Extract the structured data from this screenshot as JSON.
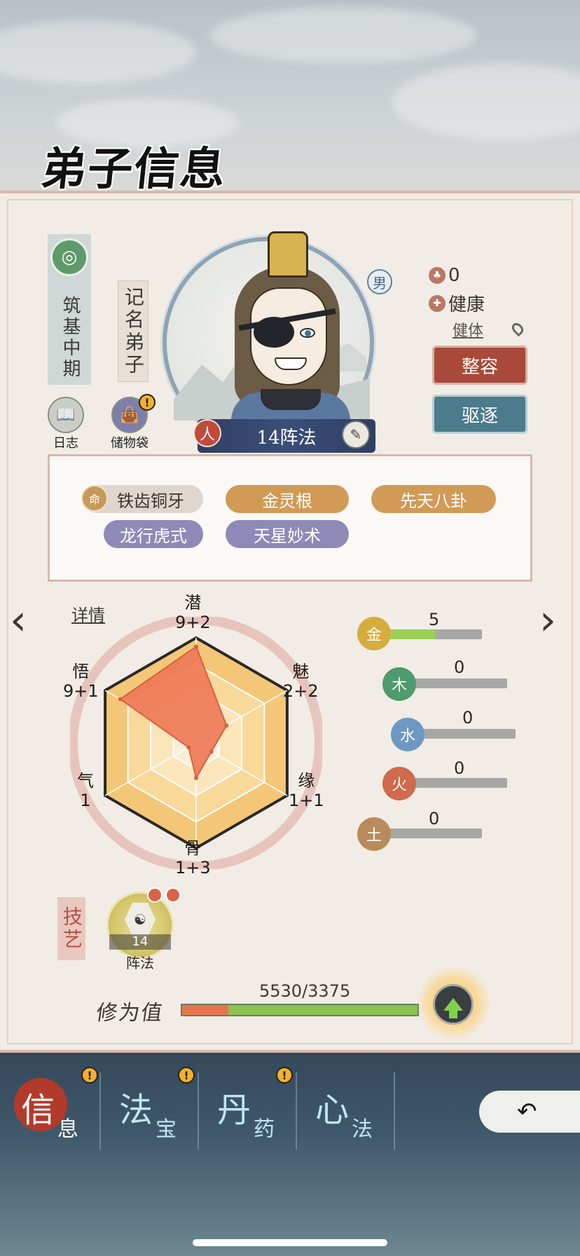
{
  "header": {
    "title": "弟子信息"
  },
  "disciple": {
    "rank": "筑基中期",
    "title_tag": "记名弟子",
    "gender": "男",
    "skill_band": "14阵法",
    "ren_badge": "人",
    "stat_count": "0",
    "health": "健康",
    "constitution": "健体",
    "buttons": {
      "reshape": "整容",
      "expel": "驱逐"
    }
  },
  "items": [
    {
      "label": "日志",
      "icon": "book-icon"
    },
    {
      "label": "储物袋",
      "icon": "bag-icon",
      "alert": "!"
    }
  ],
  "traits": {
    "ming_icon": "命",
    "row1": [
      "铁齿铜牙",
      "金灵根",
      "先天八卦"
    ],
    "row2": [
      "龙行虎式",
      "天星妙术"
    ]
  },
  "detail_link": "详情",
  "chart_data": {
    "type": "radar",
    "axes": [
      {
        "name": "潜",
        "label": "9+2",
        "base": 9,
        "bonus": 2
      },
      {
        "name": "魅",
        "label": "2+2",
        "base": 2,
        "bonus": 2
      },
      {
        "name": "缘",
        "label": "1+1",
        "base": 1,
        "bonus": 1
      },
      {
        "name": "骨",
        "label": "1+3",
        "base": 1,
        "bonus": 3
      },
      {
        "name": "气",
        "label": "1",
        "base": 1,
        "bonus": 0
      },
      {
        "name": "悟",
        "label": "9+1",
        "base": 9,
        "bonus": 1
      }
    ],
    "colors": {
      "fill": "#ee7a57",
      "bg_outer": "#f3c777",
      "bg_inner": "#fdf0d6"
    }
  },
  "elements": [
    {
      "name": "金",
      "value": 5,
      "fraction": 0.55,
      "color": "#d5ad3d"
    },
    {
      "name": "木",
      "value": 0,
      "fraction": 0,
      "color": "#4f9a6e"
    },
    {
      "name": "水",
      "value": 0,
      "fraction": 0,
      "color": "#6e98c4"
    },
    {
      "name": "火",
      "value": 0,
      "fraction": 0,
      "color": "#cf6a4a"
    },
    {
      "name": "土",
      "value": 0,
      "fraction": 0,
      "color": "#b98b5c"
    }
  ],
  "skills": {
    "side_label": "技艺",
    "medal_number": "14",
    "medal_name": "阵法",
    "bagua_icon": "☯"
  },
  "cultivation": {
    "label": "修为值",
    "value_text": "5530/3375"
  },
  "tabs": [
    {
      "big": "信",
      "small": "息",
      "active": true,
      "alert": false
    },
    {
      "big": "法",
      "small": "宝",
      "active": false,
      "alert": true
    },
    {
      "big": "丹",
      "small": "药",
      "active": false,
      "alert": true
    },
    {
      "big": "心",
      "small": "法",
      "active": false,
      "alert": true
    }
  ],
  "nav": {
    "prev": "‹",
    "next": "›"
  },
  "alert_mark": "!"
}
